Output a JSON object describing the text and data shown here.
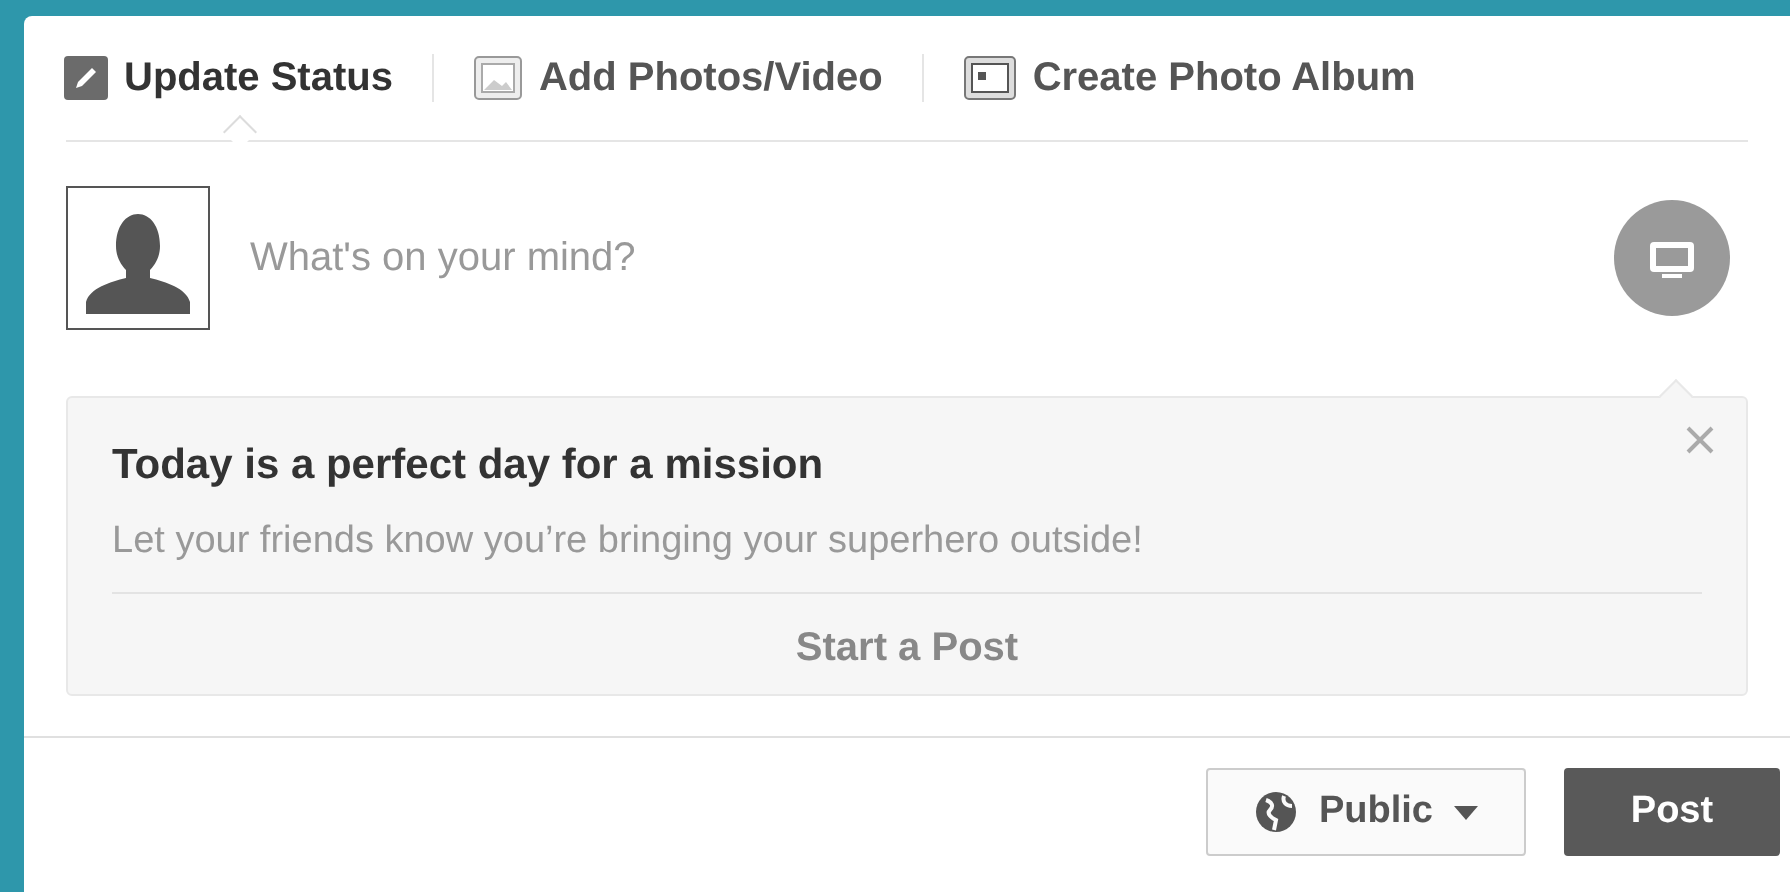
{
  "tabs": [
    {
      "label": "Update Status",
      "kind": "status",
      "selected": true
    },
    {
      "label": "Add Photos/Video",
      "kind": "photo",
      "selected": false
    },
    {
      "label": "Create Photo Album",
      "kind": "album",
      "selected": false
    }
  ],
  "composer": {
    "placeholder": "What's on your mind?"
  },
  "prompt": {
    "title": "Today is a perfect day for a mission",
    "text": "Let your friends know you’re bringing your superhero outside!",
    "action": "Start a Post"
  },
  "footer": {
    "audience": "Public",
    "post": "Post"
  }
}
